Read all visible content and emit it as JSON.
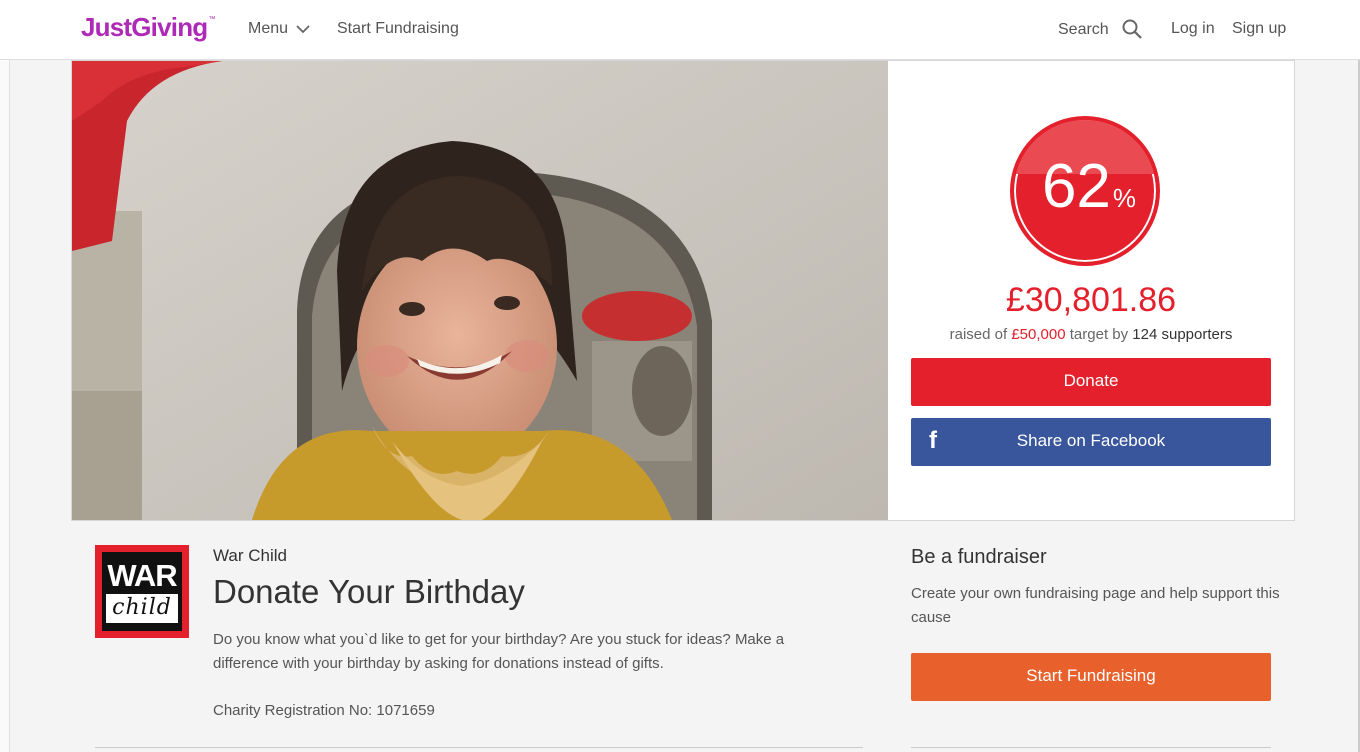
{
  "header": {
    "logo_text": "JustGiving",
    "logo_tm": "™",
    "menu_label": "Menu",
    "start_fundraising_label": "Start Fundraising",
    "search_label": "Search",
    "login_label": "Log in",
    "signup_label": "Sign up",
    "brand_color": "#ad29b6"
  },
  "stats": {
    "percent": "62",
    "percent_sign": "%",
    "raised_amount": "£30,801.86",
    "raised_prefix": "raised of",
    "target": "£50,000",
    "target_suffix": "target by",
    "supporters": "124 supporters",
    "donate_label": "Donate",
    "facebook_icon_glyph": "f",
    "facebook_label": "Share on Facebook",
    "accent_color": "#e3202b",
    "facebook_color": "#39569c"
  },
  "charity": {
    "logo_word_1": "WAR",
    "logo_word_2": "child",
    "name": "War Child",
    "page_title": "Donate Your Birthday",
    "description": "Do you know what you`d like to get for your birthday? Are you stuck for ideas? Make a difference with your birthday by asking for donations instead of gifts.",
    "registration": "Charity Registration No: 1071659"
  },
  "fundraiser": {
    "title": "Be a fundraiser",
    "description": "Create your own fundraising page and help support this cause",
    "button_label": "Start Fundraising",
    "button_color": "#e8602b"
  }
}
